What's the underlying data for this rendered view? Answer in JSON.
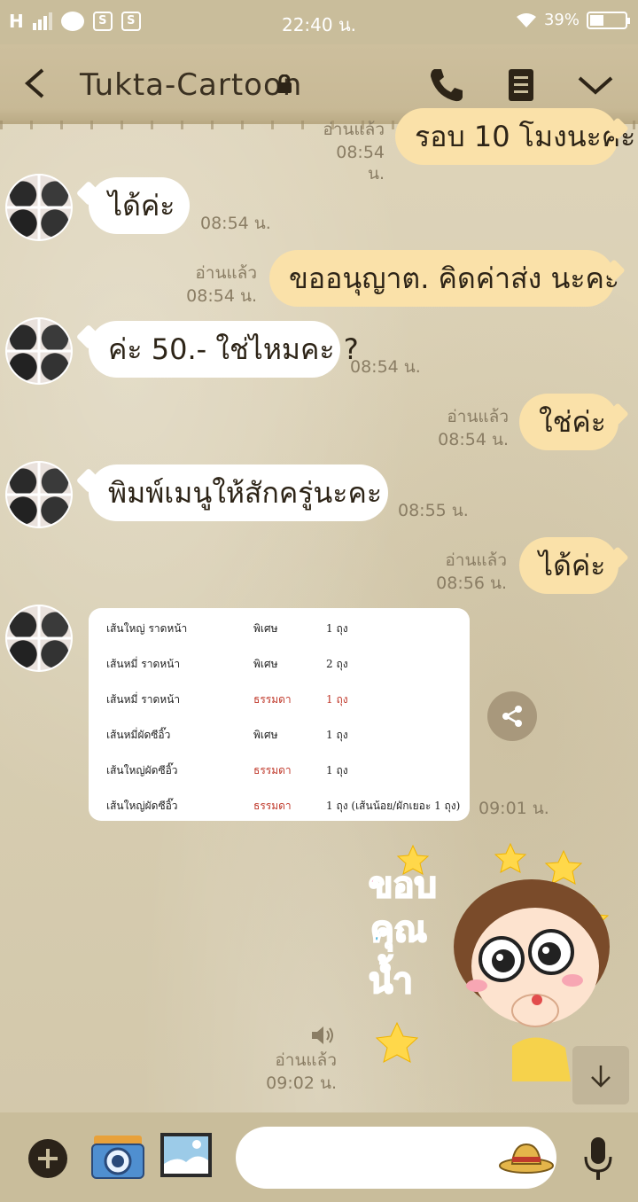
{
  "status_bar": {
    "network": "H",
    "time": "22:40 น.",
    "battery": "39%"
  },
  "header": {
    "title": "Tukta-Cartoon"
  },
  "messages": [
    {
      "text": "รอบ 10 โมงนะคะ",
      "read": "อ่านแล้ว",
      "time": "08:54 น."
    },
    {
      "text": "ได้ค่ะ",
      "time": "08:54 น."
    },
    {
      "text": "ขออนุญาต. คิดค่าส่ง นะคะ",
      "read": "อ่านแล้ว",
      "time": "08:54 น."
    },
    {
      "text": "ค่ะ 50.- ใช่ไหมคะ ?",
      "time": "08:54 น."
    },
    {
      "text": "ใช่ค่ะ",
      "read": "อ่านแล้ว",
      "time": "08:54 น."
    },
    {
      "text": "พิมพ์เมนูให้สักครู่นะคะ",
      "time": "08:55 น."
    },
    {
      "text": "ได้ค่ะ",
      "read": "อ่านแล้ว",
      "time": "08:56 น."
    }
  ],
  "image_message": {
    "time": "09:01 น.",
    "rows": [
      {
        "item": "เส้นใหญ่ ราดหน้า",
        "type": "พิเศษ",
        "qty": "1 ถุง",
        "highlight": false
      },
      {
        "item": "เส้นหมี่ ราดหน้า",
        "type": "พิเศษ",
        "qty": "2 ถุง",
        "highlight": false
      },
      {
        "item": "เส้นหมี่ ราดหน้า",
        "type": "ธรรมดา",
        "qty": "1 ถุง",
        "highlight": true
      },
      {
        "item": "เส้นหมี่ผัดซีอิ๊ว",
        "type": "พิเศษ",
        "qty": "1 ถุง",
        "highlight": false
      },
      {
        "item": "เส้นใหญ่ผัดซีอิ๊ว",
        "type": "ธรรมดา",
        "qty": "1 ถุง",
        "highlight": false
      },
      {
        "item": "เส้นใหญ่ผัดซีอิ๊ว",
        "type": "ธรรมดา",
        "qty": "1 ถุง (เส้นน้อย/ผักเยอะ 1 ถุง)",
        "highlight": false
      }
    ]
  },
  "sticker_message": {
    "words": [
      "ขอบ",
      "คุณ",
      "น้ำ"
    ],
    "read": "อ่านแล้ว",
    "time": "09:02 น."
  },
  "colors": {
    "outgoing_bubble": "#fae1a9",
    "incoming_bubble": "#ffffff",
    "bar": "#c9bd9b"
  }
}
